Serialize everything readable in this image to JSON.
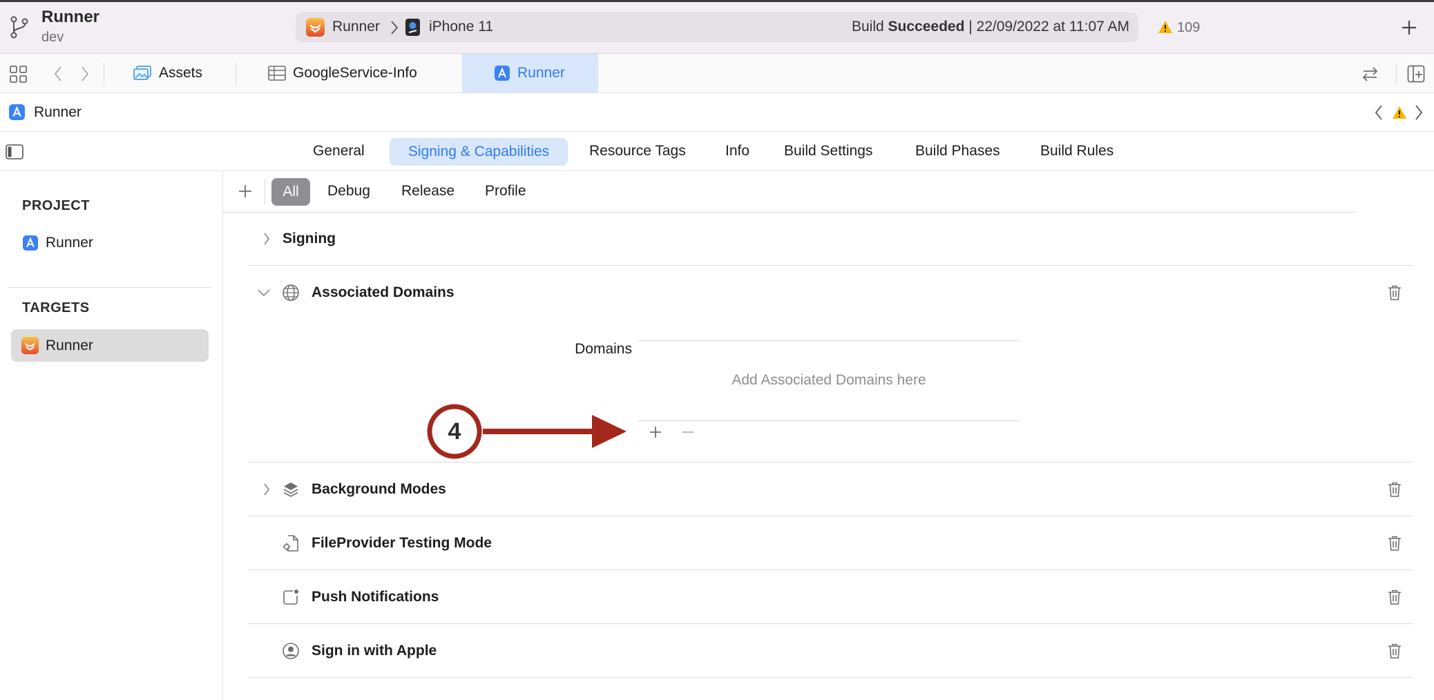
{
  "window": {
    "title": "Runner",
    "branch": "dev"
  },
  "scheme": {
    "target": "Runner",
    "device": "iPhone 11"
  },
  "build_status": {
    "prefix": "Build",
    "result": "Succeeded",
    "detail": "| 22/09/2022 at 11:07 AM"
  },
  "issues": {
    "warnings": "109"
  },
  "file_tabs": [
    {
      "label": "Assets",
      "icon": "image-icon",
      "active": false
    },
    {
      "label": "GoogleService-Info",
      "icon": "table-icon",
      "active": false
    },
    {
      "label": "Runner",
      "icon": "app-icon",
      "active": true
    }
  ],
  "jump_bar": {
    "label": "Runner"
  },
  "editor_tabs": [
    {
      "label": "General"
    },
    {
      "label": "Signing & Capabilities",
      "selected": true
    },
    {
      "label": "Resource Tags"
    },
    {
      "label": "Info"
    },
    {
      "label": "Build Settings"
    },
    {
      "label": "Build Phases"
    },
    {
      "label": "Build Rules"
    }
  ],
  "sidebar": {
    "project_heading": "PROJECT",
    "project_items": [
      {
        "label": "Runner",
        "icon": "app-icon"
      }
    ],
    "targets_heading": "TARGETS",
    "target_items": [
      {
        "label": "Runner",
        "icon": "runner-app-icon",
        "selected": true
      }
    ]
  },
  "config_filter": {
    "options": [
      "All",
      "Debug",
      "Release",
      "Profile"
    ],
    "selected": "All"
  },
  "capabilities": [
    {
      "title": "Signing",
      "expanded": false
    },
    {
      "title": "Associated Domains",
      "icon": "globe-icon",
      "expanded": true
    },
    {
      "title": "Background Modes",
      "icon": "layers-icon",
      "expanded": false
    },
    {
      "title": "FileProvider Testing Mode",
      "icon": "document-gear-icon"
    },
    {
      "title": "Push Notifications",
      "icon": "notification-badge-icon"
    },
    {
      "title": "Sign in with Apple",
      "icon": "person-circle-icon"
    }
  ],
  "associated_domains": {
    "field_label": "Domains",
    "placeholder": "Add Associated Domains here"
  },
  "annotation": {
    "step": "4"
  },
  "colors": {
    "accent": "#2f7cf6",
    "selected_tab_bg": "#d8e7fb",
    "warning": "#f7b500",
    "annotation": "#a4271c",
    "toolbar_bg": "#f3eef4"
  }
}
